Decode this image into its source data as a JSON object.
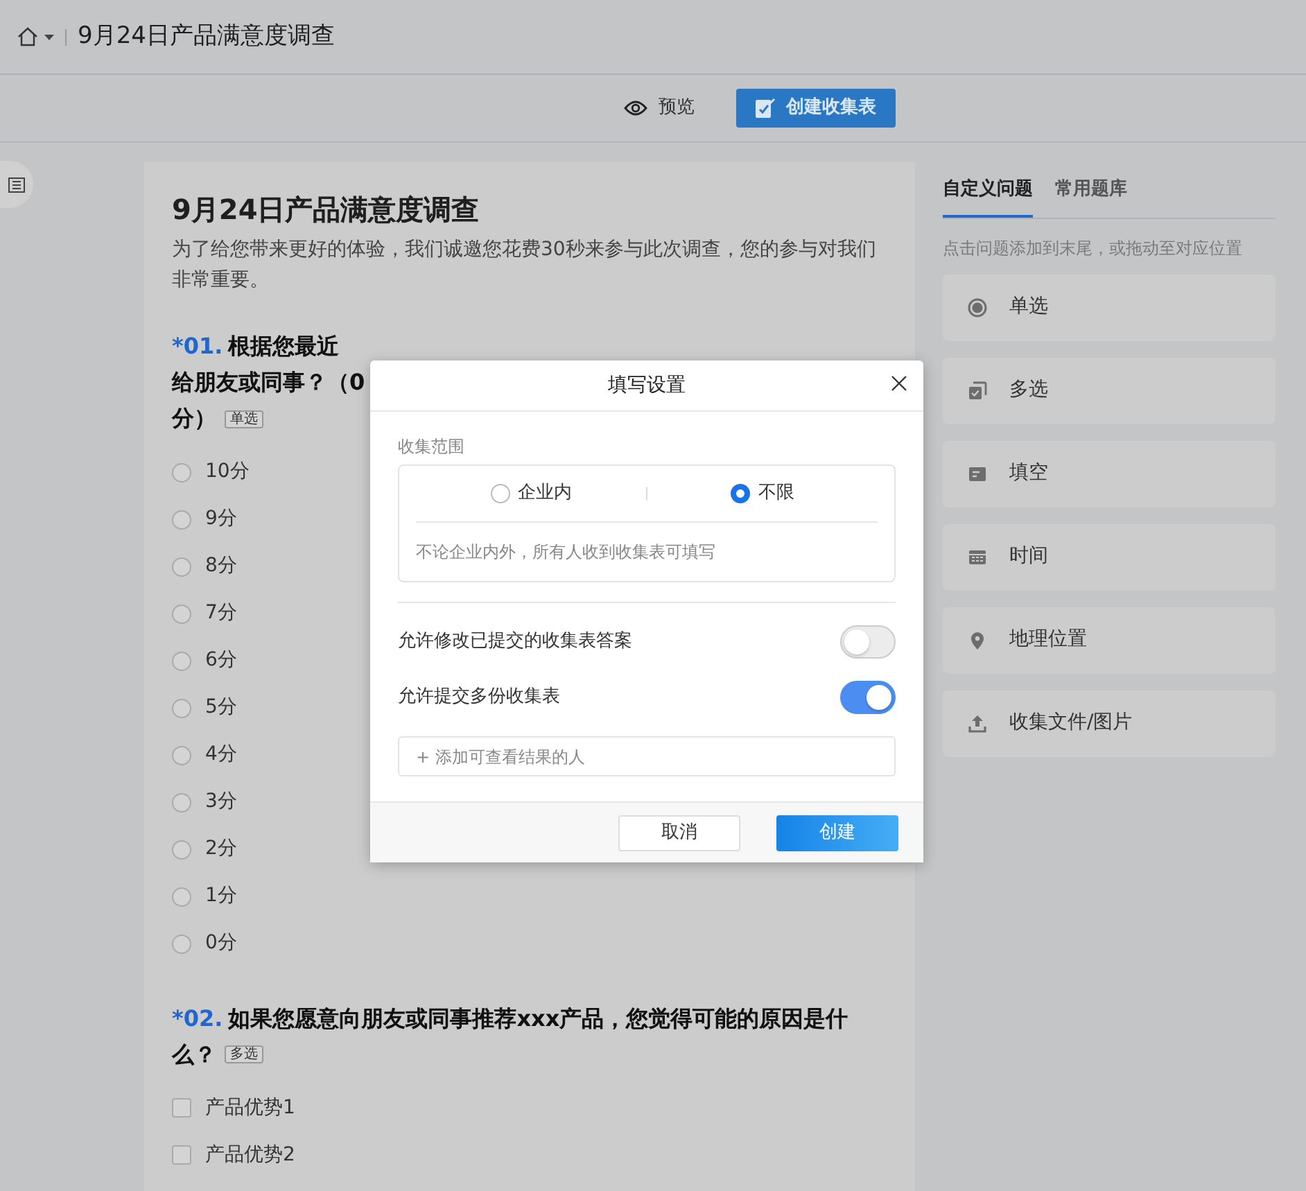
{
  "header": {
    "title": "9月24日产品满意度调查"
  },
  "toolbar": {
    "preview": "预览",
    "create": "创建收集表"
  },
  "survey": {
    "title": "9月24日产品满意度调查",
    "description": "为了给您带来更好的体验，我们诚邀您花费30秒来参与此次调查，您的参与对我们非常重要。",
    "questions": [
      {
        "number": "*01.",
        "lines": [
          "根据您最近",
          "给朋友或同事？（0",
          "分）"
        ],
        "type_tag": "单选",
        "kind": "radio",
        "options": [
          {
            "label": "10分",
            "checked": false
          },
          {
            "label": "9分",
            "checked": false
          },
          {
            "label": "8分",
            "checked": false
          },
          {
            "label": "7分",
            "checked": false
          },
          {
            "label": "6分",
            "checked": false
          },
          {
            "label": "5分",
            "checked": false
          },
          {
            "label": "4分",
            "checked": false
          },
          {
            "label": "3分",
            "checked": false
          },
          {
            "label": "2分",
            "checked": false
          },
          {
            "label": "1分",
            "checked": false
          },
          {
            "label": "0分",
            "checked": false
          }
        ]
      },
      {
        "number": "*02.",
        "lines": [
          "如果您愿意向朋友或同事推荐xxx产品，您觉得可能的原因是什",
          "么？"
        ],
        "type_tag": "多选",
        "kind": "checkbox",
        "options": [
          {
            "label": "产品优势1",
            "checked": false
          },
          {
            "label": "产品优势2",
            "checked": false
          }
        ]
      }
    ]
  },
  "panel": {
    "tabs": [
      {
        "label": "自定义问题",
        "selected": true
      },
      {
        "label": "常用题库",
        "selected": false
      }
    ],
    "hint": "点击问题添加到末尾，或拖动至对应位置",
    "items": [
      {
        "label": "单选",
        "kind": "radio"
      },
      {
        "label": "多选",
        "kind": "checkbox"
      },
      {
        "label": "填空",
        "kind": "text"
      },
      {
        "label": "时间",
        "kind": "time"
      },
      {
        "label": "地理位置",
        "kind": "location"
      },
      {
        "label": "收集文件/图片",
        "kind": "upload"
      }
    ]
  },
  "dialog": {
    "title": "填写设置",
    "scope_label": "收集范围",
    "scope_options": [
      {
        "label": "企业内",
        "selected": false
      },
      {
        "label": "不限",
        "selected": true
      }
    ],
    "scope_note": "不论企业内外，所有人收到收集表可填写",
    "switches": [
      {
        "label": "允许修改已提交的收集表答案",
        "on": false
      },
      {
        "label": "允许提交多份收集表",
        "on": true
      }
    ],
    "add_viewer": "+ 添加可查看结果的人",
    "buttons": [
      {
        "label": "取消",
        "kind": "secondary"
      },
      {
        "label": "创建",
        "kind": "primary"
      }
    ]
  }
}
